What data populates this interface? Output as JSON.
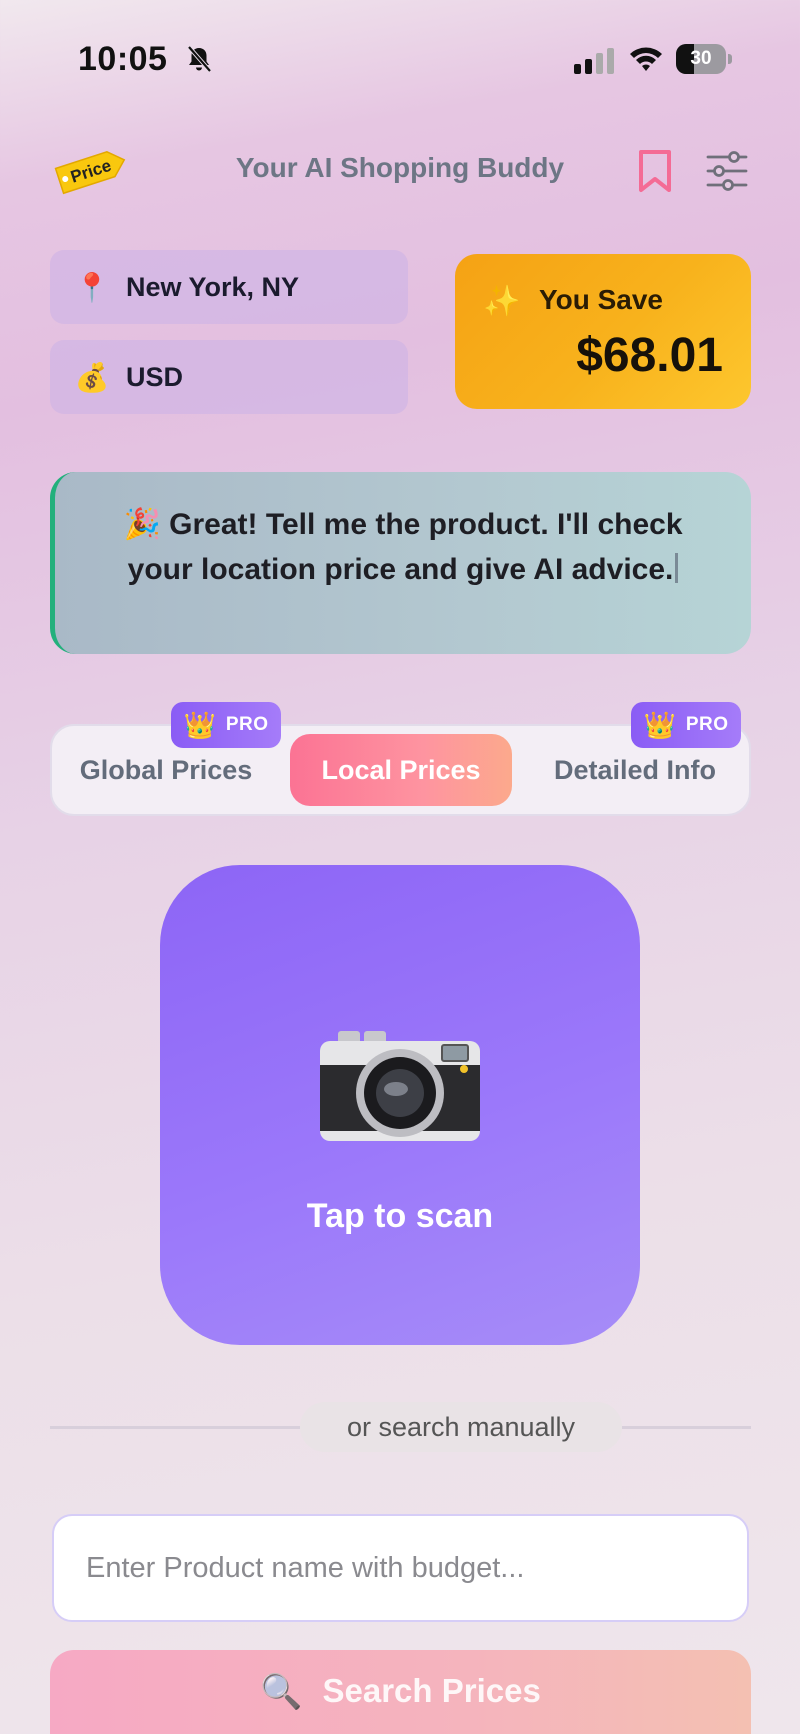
{
  "status_bar": {
    "time": "10:05",
    "battery_level": "30",
    "icons": [
      "bell-slash-icon",
      "cellular-signal-icon",
      "wifi-icon",
      "battery-icon"
    ]
  },
  "header": {
    "logo_text": "Price",
    "title": "Your AI Shopping Buddy",
    "icons": [
      "bookmark-icon",
      "filter-sliders-icon"
    ],
    "bookmark_color": "#f46b95"
  },
  "location": {
    "icon": "📍",
    "label": "New York, NY"
  },
  "currency": {
    "icon": "💰",
    "label": "USD"
  },
  "savings": {
    "icon": "✨",
    "label": "You Save",
    "amount": "$68.01",
    "color": "#f8b21c"
  },
  "ai_message": {
    "icon": "🎉",
    "text": "Great! Tell me the product. I'll check your location price and give AI advice."
  },
  "tabs": [
    {
      "label": "Global Prices",
      "pro": true,
      "active": false
    },
    {
      "label": "Local Prices",
      "pro": false,
      "active": true
    },
    {
      "label": "Detailed Info",
      "pro": true,
      "active": false
    }
  ],
  "pro_badge": {
    "icon": "👑",
    "label": "PRO"
  },
  "scan": {
    "icon": "camera-icon",
    "label": "Tap to scan",
    "color": "#9b78fa"
  },
  "divider": {
    "label": "or search manually"
  },
  "search": {
    "placeholder": "Enter Product name with budget...",
    "value": ""
  },
  "search_button": {
    "icon": "🔍",
    "label": "Search Prices"
  }
}
